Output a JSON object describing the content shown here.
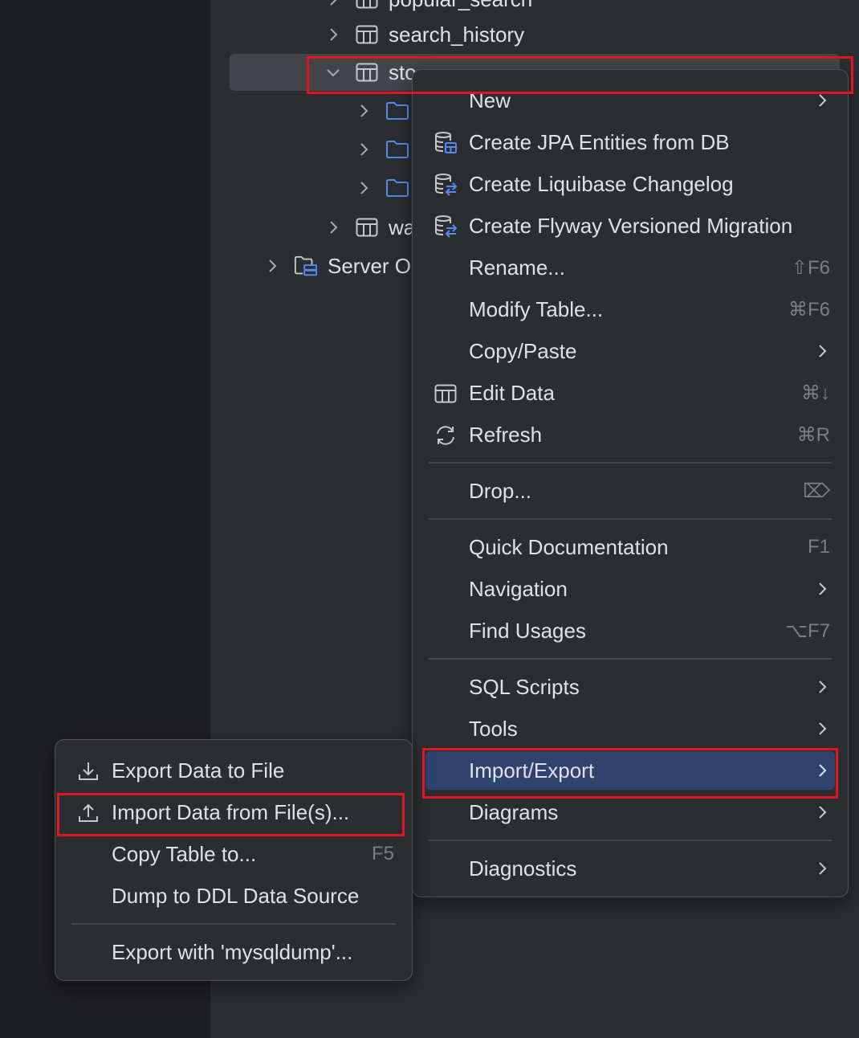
{
  "tree": {
    "rows": [
      {
        "label": "popular_search"
      },
      {
        "label": "search_history"
      },
      {
        "label": "sto"
      },
      {
        "label": ""
      },
      {
        "label": ""
      },
      {
        "label": ""
      },
      {
        "label": "wa"
      },
      {
        "label": "Server O"
      }
    ]
  },
  "context_menu": {
    "items": {
      "new": {
        "label": "New"
      },
      "jpa": {
        "label": "Create JPA Entities from DB"
      },
      "liquibase": {
        "label": "Create Liquibase Changelog"
      },
      "flyway": {
        "label": "Create Flyway Versioned Migration"
      },
      "rename": {
        "label": "Rename...",
        "shortcut": "⇧F6"
      },
      "modify": {
        "label": "Modify Table...",
        "shortcut": "⌘F6"
      },
      "copypaste": {
        "label": "Copy/Paste"
      },
      "edit": {
        "label": "Edit Data",
        "shortcut": "⌘↓"
      },
      "refresh": {
        "label": "Refresh",
        "shortcut": "⌘R"
      },
      "drop": {
        "label": "Drop...",
        "shortcut": "⌦"
      },
      "quickdoc": {
        "label": "Quick Documentation",
        "shortcut": "F1"
      },
      "navigation": {
        "label": "Navigation"
      },
      "findusages": {
        "label": "Find Usages",
        "shortcut": "⌥F7"
      },
      "sqlscripts": {
        "label": "SQL Scripts"
      },
      "tools": {
        "label": "Tools"
      },
      "importexport": {
        "label": "Import/Export"
      },
      "diagrams": {
        "label": "Diagrams"
      },
      "diagnostics": {
        "label": "Diagnostics"
      }
    }
  },
  "submenu": {
    "items": {
      "export_file": {
        "label": "Export Data to File"
      },
      "import_file": {
        "label": "Import Data from File(s)..."
      },
      "copy_table": {
        "label": "Copy Table to...",
        "shortcut": "F5"
      },
      "dump_ddl": {
        "label": "Dump to DDL Data Source"
      },
      "mysqldump": {
        "label": "Export with 'mysqldump'..."
      }
    }
  },
  "colors": {
    "accent_selected": "#2e436e",
    "highlight_box": "#e0161f",
    "folder_icon": "#548af7"
  }
}
